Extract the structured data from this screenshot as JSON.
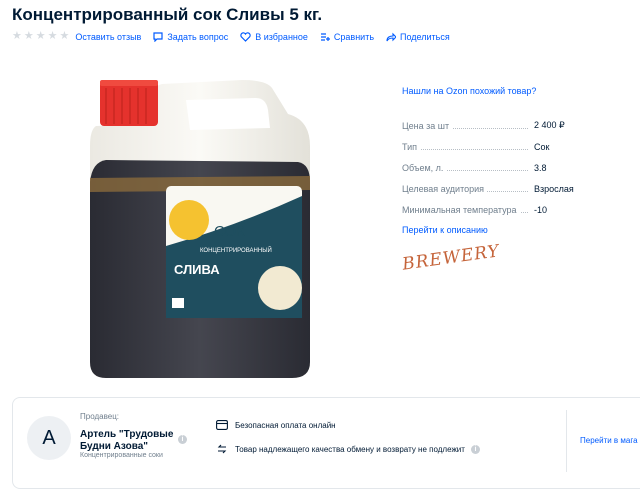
{
  "product": {
    "title": "Концентрированный сок Сливы 5 кг.",
    "image_alt": "Канистра концентрированного сока Сливы",
    "label_text": {
      "top": "СОК",
      "sub": "КОНЦЕНТРИРОВАННЫЙ",
      "name": "СЛИВА"
    }
  },
  "actions": {
    "rating_stars": 0,
    "review": "Оставить отзыв",
    "question": "Задать вопрос",
    "favorite": "В избранное",
    "compare": "Сравнить",
    "share": "Поделиться"
  },
  "info": {
    "similar_link": "Нашли на Ozon похожий товар?",
    "specs": [
      {
        "label": "Цена за шт",
        "value": "2 400 ₽"
      },
      {
        "label": "Тип",
        "value": "Сок"
      },
      {
        "label": "Объем, л.",
        "value": "3.8"
      },
      {
        "label": "Целевая аудитория",
        "value": "Взрослая"
      },
      {
        "label": "Минимальная температура",
        "value": "-10"
      }
    ],
    "description_link": "Перейти к описанию",
    "brand_logo": "BREWERY"
  },
  "seller": {
    "label": "Продавец:",
    "avatar_letter": "А",
    "name": "Артель \"Трудовые Будни Азова\"",
    "category": "Концентрированные соки",
    "features": [
      "Безопасная оплата онлайн",
      "Товар надлежащего качества обмену и возврату не подлежит"
    ],
    "store_link": "Перейти в мага"
  },
  "colors": {
    "accent": "#005bff",
    "text": "#001a34",
    "muted": "#707f8d",
    "cap": "#e5322d",
    "liquid": "#3a3a44"
  }
}
